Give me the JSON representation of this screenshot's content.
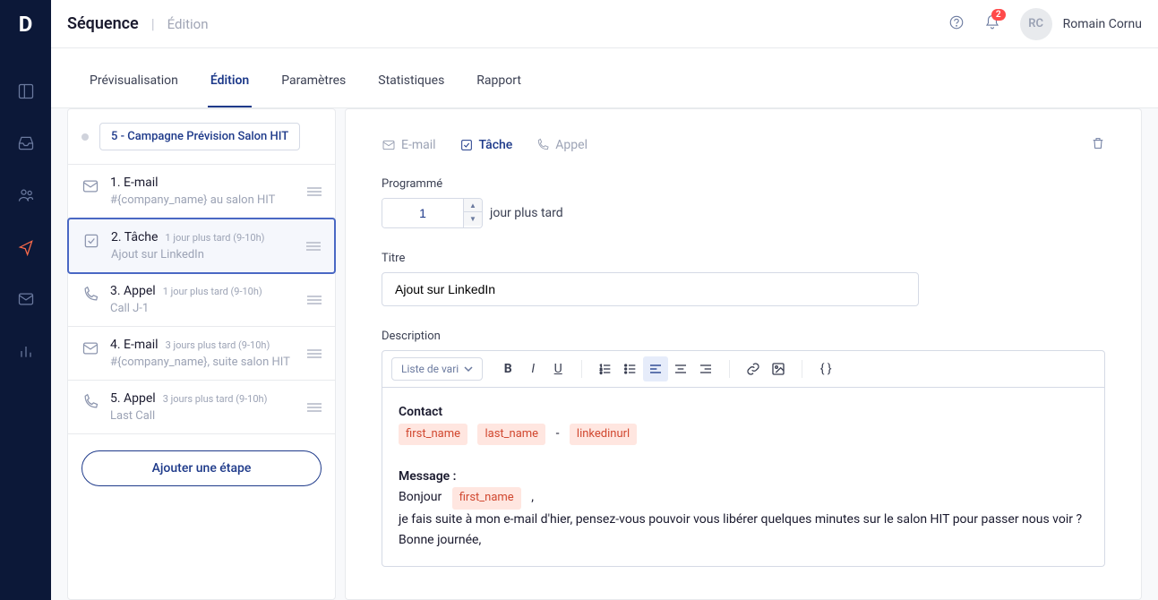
{
  "breadcrumb": {
    "title": "Séquence",
    "sub": "Édition"
  },
  "user": {
    "initials": "RC",
    "name": "Romain Cornu"
  },
  "notification_count": "2",
  "tabs": [
    {
      "label": "Prévisualisation"
    },
    {
      "label": "Édition"
    },
    {
      "label": "Paramètres"
    },
    {
      "label": "Statistiques"
    },
    {
      "label": "Rapport"
    }
  ],
  "campaign": {
    "name": "5 - Campagne Prévision Salon HIT"
  },
  "steps": [
    {
      "title": "1. E-mail",
      "meta": "",
      "sub": "#{company_name} au salon HIT"
    },
    {
      "title": "2. Tâche",
      "meta": "1 jour plus tard (9-10h)",
      "sub": "Ajout sur LinkedIn"
    },
    {
      "title": "3. Appel",
      "meta": "1 jour plus tard (9-10h)",
      "sub": "Call J-1"
    },
    {
      "title": "4. E-mail",
      "meta": "3 jours plus tard (9-10h)",
      "sub": "#{company_name}, suite salon HIT"
    },
    {
      "title": "5. Appel",
      "meta": "3 jours plus tard (9-10h)",
      "sub": "Last Call"
    }
  ],
  "add_step_label": "Ajouter une étape",
  "type_tabs": {
    "email": "E-mail",
    "task": "Tâche",
    "call": "Appel"
  },
  "form": {
    "scheduled_label": "Programmé",
    "scheduled_value": "1",
    "scheduled_suffix": "jour plus tard",
    "title_label": "Titre",
    "title_value": "Ajout sur LinkedIn",
    "description_label": "Description",
    "var_select": "Liste de vari"
  },
  "editor": {
    "contact_label": "Contact",
    "vars": {
      "first_name": "first_name",
      "last_name": "last_name",
      "linkedinurl": "linkedinurl"
    },
    "dash": "-",
    "message_label": "Message :",
    "greeting": "Bonjour",
    "comma": ",",
    "line2": "je fais suite à mon e-mail d'hier, pensez-vous pouvoir vous libérer quelques minutes sur le salon HIT pour passer nous voir ?",
    "line3": "Bonne journée,"
  }
}
